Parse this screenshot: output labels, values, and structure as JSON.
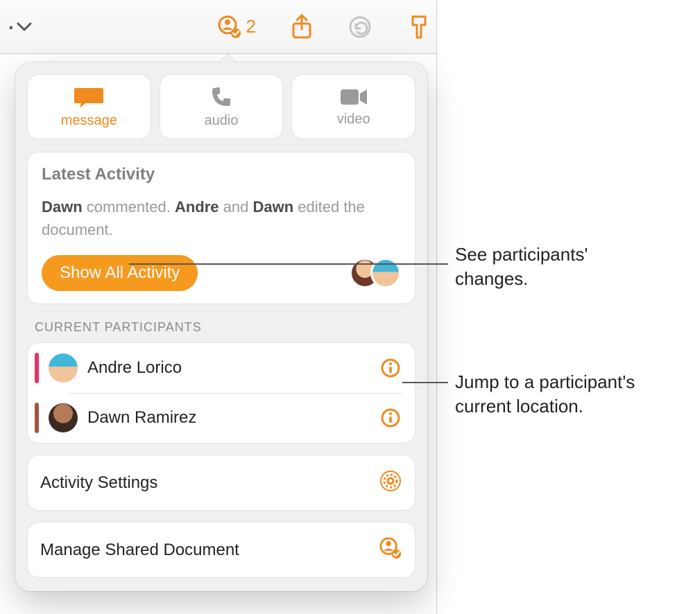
{
  "toolbar": {
    "collaborate_count": "2"
  },
  "tabs": {
    "message": "message",
    "audio": "audio",
    "video": "video"
  },
  "latest": {
    "title": "Latest Activity",
    "p1": "Dawn",
    "p2": " commented. ",
    "p3": "Andre",
    "p4": " and ",
    "p5": "Dawn",
    "p6": " edited the document.",
    "button": "Show All Activity"
  },
  "participants": {
    "heading": "CURRENT PARTICIPANTS",
    "items": [
      {
        "name": "Andre Lorico",
        "color": "#e6326a"
      },
      {
        "name": "Dawn Ramirez",
        "color": "#a5553f"
      }
    ]
  },
  "actions": {
    "settings": "Activity Settings",
    "manage": "Manage Shared Document"
  },
  "callouts": {
    "c1": "See participants' changes.",
    "c2": "Jump to a participant's current location."
  }
}
